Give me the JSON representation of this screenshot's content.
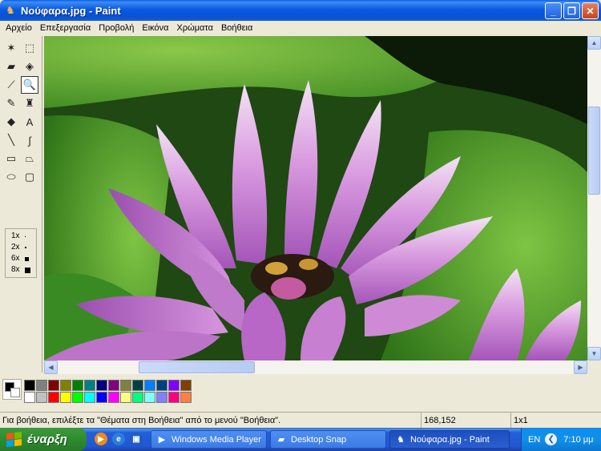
{
  "window": {
    "title": "Νούφαρα.jpg - Paint",
    "minimize_label": "_",
    "maximize_label": "❐",
    "close_label": "✕"
  },
  "menu": [
    "Αρχείο",
    "Επεξεργασία",
    "Προβολή",
    "Εικόνα",
    "Χρώματα",
    "Βοήθεια"
  ],
  "toolbox": {
    "tools": [
      {
        "name": "free-select-icon",
        "glyph": "✶"
      },
      {
        "name": "select-icon",
        "glyph": "⬚"
      },
      {
        "name": "eraser-icon",
        "glyph": "▰"
      },
      {
        "name": "fill-icon",
        "glyph": "◈"
      },
      {
        "name": "color-picker-icon",
        "glyph": "⟋"
      },
      {
        "name": "magnifier-icon",
        "glyph": "🔍",
        "active": true
      },
      {
        "name": "pencil-icon",
        "glyph": "✎"
      },
      {
        "name": "brush-icon",
        "glyph": "♜"
      },
      {
        "name": "airbrush-icon",
        "glyph": "◆"
      },
      {
        "name": "text-icon",
        "glyph": "A"
      },
      {
        "name": "line-icon",
        "glyph": "╲"
      },
      {
        "name": "curve-icon",
        "glyph": "∫"
      },
      {
        "name": "rectangle-icon",
        "glyph": "▭"
      },
      {
        "name": "polygon-icon",
        "glyph": "⏢"
      },
      {
        "name": "ellipse-icon",
        "glyph": "⬭"
      },
      {
        "name": "rounded-rect-icon",
        "glyph": "▢"
      }
    ],
    "zoom_levels": [
      "1x",
      "2x",
      "6x",
      "8x"
    ]
  },
  "scrollbars": {
    "up": "▲",
    "down": "▼",
    "left": "◀",
    "right": "▶"
  },
  "palette": {
    "foreground": "#000000",
    "background": "#ffffff",
    "colors": [
      "#000000",
      "#808080",
      "#800000",
      "#808000",
      "#008000",
      "#008080",
      "#000080",
      "#800080",
      "#808040",
      "#004040",
      "#0080ff",
      "#004080",
      "#8000ff",
      "#804000",
      "#ffffff",
      "#c0c0c0",
      "#ff0000",
      "#ffff00",
      "#00ff00",
      "#00ffff",
      "#0000ff",
      "#ff00ff",
      "#ffff80",
      "#00ff80",
      "#80ffff",
      "#8080ff",
      "#ff0080",
      "#ff8040"
    ]
  },
  "status": {
    "help_text": "Για βοήθεια, επιλέξτε τα \"Θέματα στη Βοήθεια\" από το μενού \"Βοήθεια\".",
    "coordinates": "168,152",
    "selection_size": "1x1"
  },
  "taskbar": {
    "start_label": "έναρξη",
    "tasks": [
      {
        "label": "Windows Media Player",
        "icon": "▶",
        "active": false
      },
      {
        "label": "Desktop Snap",
        "icon": "▰",
        "active": false
      },
      {
        "label": "Νούφαρα.jpg - Paint",
        "icon": "♞",
        "active": true
      }
    ],
    "language": "EN",
    "clock": "7:10 μμ"
  }
}
